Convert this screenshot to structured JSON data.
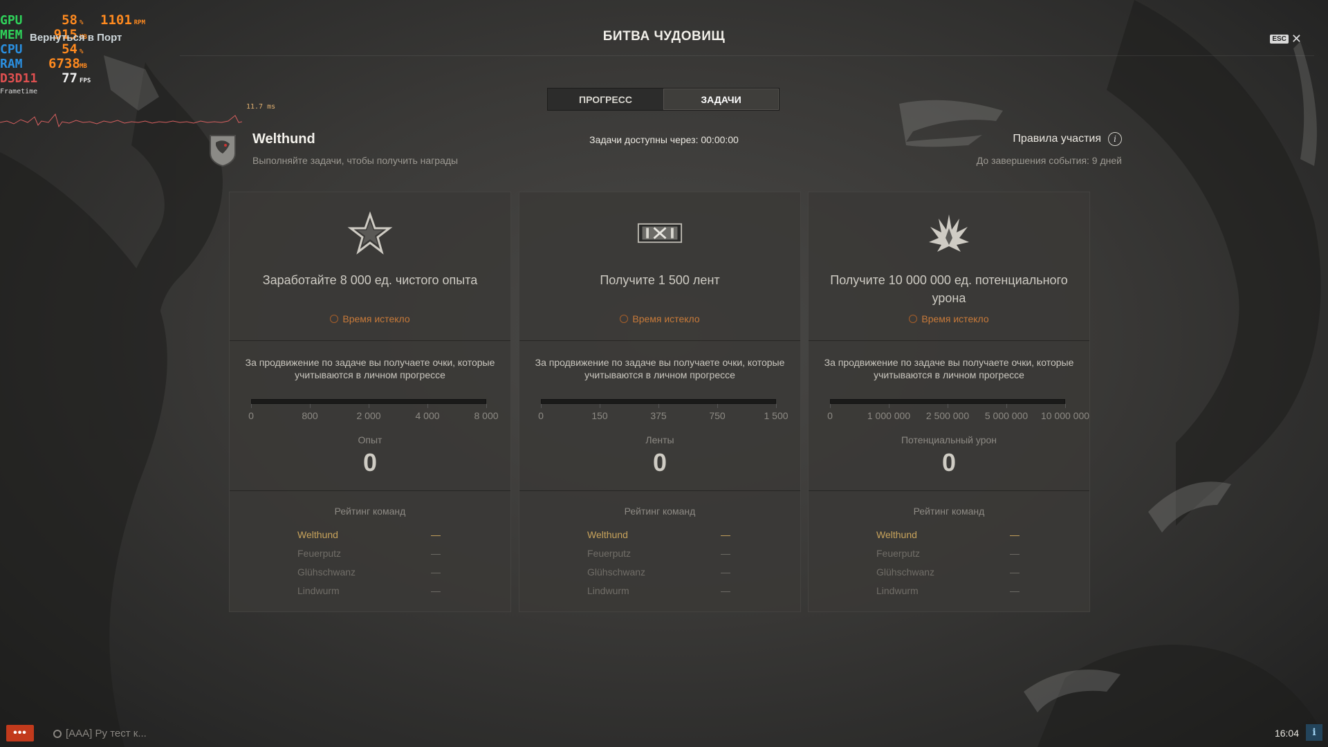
{
  "osd": {
    "rows": [
      {
        "label": "GPU",
        "value": "58",
        "unit": "%",
        "extra": "1101",
        "extra_unit": "RPM",
        "color": "#2fd15a"
      },
      {
        "label": "MEM",
        "value": "915",
        "unit": "MB",
        "color": "#2fd15a"
      },
      {
        "label": "CPU",
        "value": "54",
        "unit": "%",
        "color": "#2a8fe0"
      },
      {
        "label": "RAM",
        "value": "6738",
        "unit": "MB",
        "color": "#2a8fe0"
      },
      {
        "label": "D3D11",
        "value": "77",
        "unit": "FPS",
        "color": "#e05050"
      }
    ],
    "frametime_label": "Frametime",
    "frametime_ms": "11.7 ms",
    "back_link": "Вернуться в Порт"
  },
  "header": {
    "title": "БИТВА ЧУДОВИЩ",
    "esc_label": "ESC",
    "close_symbol": "✕"
  },
  "tabs": [
    {
      "label": "ПРОГРЕСС",
      "active": false
    },
    {
      "label": "ЗАДАЧИ",
      "active": true
    }
  ],
  "team": {
    "name": "Welthund",
    "subtitle": "Выполняйте задачи, чтобы получить награды"
  },
  "availability": "Задачи доступны через: 00:00:00",
  "rules": {
    "label": "Правила участия",
    "info_icon": "info-icon",
    "ends": "До завершения события: 9 дней"
  },
  "cards": [
    {
      "icon": "star-icon",
      "title": "Заработайте 8 000 ед. чистого опыта",
      "status": "Время истекло",
      "description": "За продвижение по задаче вы получаете очки, которые учитываются в личном прогрессе",
      "progress": 0,
      "ticks": [
        "0",
        "800",
        "2 000",
        "4 000",
        "8 000"
      ],
      "metric_label": "Опыт",
      "metric_value": "0",
      "ranking_title": "Рейтинг команд",
      "ranking": [
        {
          "team": "Welthund",
          "value": "—",
          "own": true
        },
        {
          "team": "Feuerputz",
          "value": "—",
          "own": false
        },
        {
          "team": "Glühschwanz",
          "value": "—",
          "own": false
        },
        {
          "team": "Lindwurm",
          "value": "—",
          "own": false
        }
      ]
    },
    {
      "icon": "ribbon-icon",
      "title": "Получите 1 500 лент",
      "status": "Время истекло",
      "description": "За продвижение по задаче вы получаете очки, которые учитываются в личном прогрессе",
      "progress": 0,
      "ticks": [
        "0",
        "150",
        "375",
        "750",
        "1 500"
      ],
      "metric_label": "Ленты",
      "metric_value": "0",
      "ranking_title": "Рейтинг команд",
      "ranking": [
        {
          "team": "Welthund",
          "value": "—",
          "own": true
        },
        {
          "team": "Feuerputz",
          "value": "—",
          "own": false
        },
        {
          "team": "Glühschwanz",
          "value": "—",
          "own": false
        },
        {
          "team": "Lindwurm",
          "value": "—",
          "own": false
        }
      ]
    },
    {
      "icon": "explosion-icon",
      "title": "Получите 10 000 000 ед. потенциального урона",
      "status": "Время истекло",
      "description": "За продвижение по задаче вы получаете очки, которые учитываются в личном прогрессе",
      "progress": 0,
      "ticks": [
        "0",
        "1 000 000",
        "2 500 000",
        "5 000 000",
        "10 000 000"
      ],
      "metric_label": "Потенциальный урон",
      "metric_value": "0",
      "ranking_title": "Рейтинг команд",
      "ranking": [
        {
          "team": "Welthund",
          "value": "—",
          "own": true
        },
        {
          "team": "Feuerputz",
          "value": "—",
          "own": false
        },
        {
          "team": "Glühschwanz",
          "value": "—",
          "own": false
        },
        {
          "team": "Lindwurm",
          "value": "—",
          "own": false
        }
      ]
    }
  ],
  "bottom": {
    "chat_button": "•••",
    "chat_channel": "[AAA] Ру тест к...",
    "clock": "16:04",
    "notif_symbol": "i"
  },
  "colors": {
    "expired": "#c87a3a",
    "own_team": "#c9a45c"
  }
}
